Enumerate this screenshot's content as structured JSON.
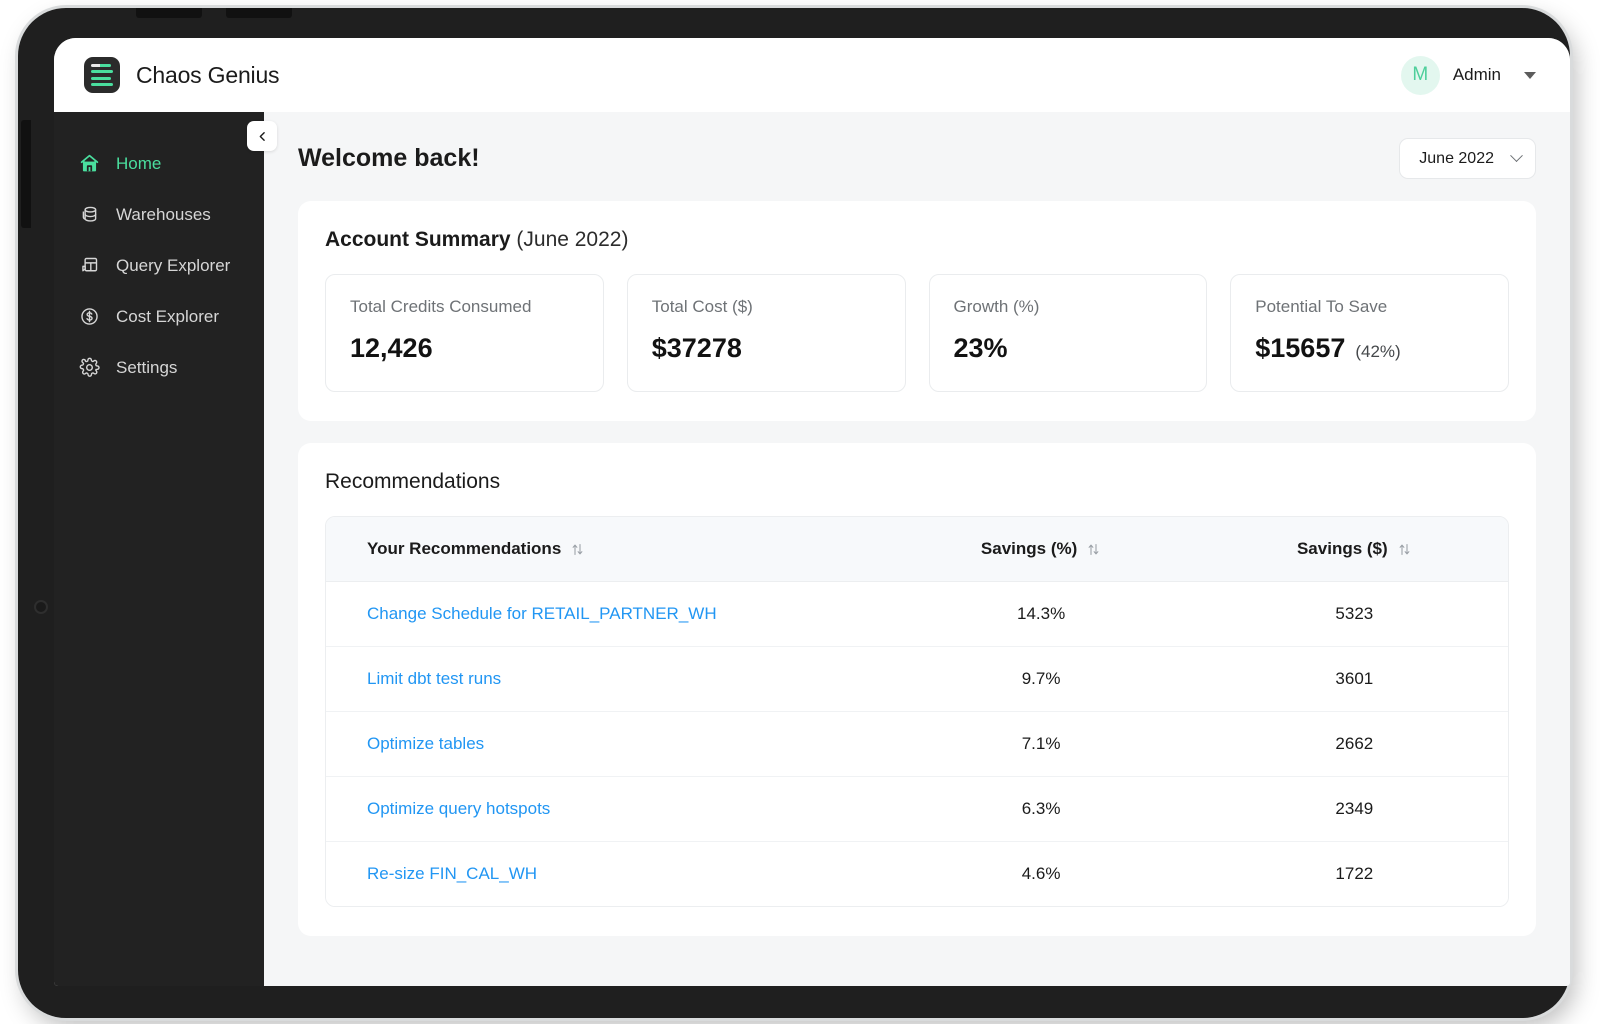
{
  "app": {
    "brand_name": "Chaos Genius",
    "logo_icon": "chaos-genius-logo"
  },
  "user": {
    "avatar_initial": "M",
    "name": "Admin",
    "caret_icon": "caret-down-icon"
  },
  "sidebar": {
    "collapse_icon": "chevron-left-icon",
    "items": [
      {
        "label": "Home",
        "icon": "home-icon",
        "active": true
      },
      {
        "label": "Warehouses",
        "icon": "database-stack-icon",
        "active": false
      },
      {
        "label": "Query Explorer",
        "icon": "query-icon",
        "active": false
      },
      {
        "label": "Cost Explorer",
        "icon": "dollar-circle-icon",
        "active": false
      },
      {
        "label": "Settings",
        "icon": "gear-icon",
        "active": false
      }
    ]
  },
  "page": {
    "title": "Welcome back!",
    "month_picker": {
      "value": "June 2022",
      "chevron_icon": "chevron-down-icon"
    }
  },
  "account_summary": {
    "title": "Account Summary",
    "period": "(June 2022)",
    "cards": [
      {
        "label": "Total Credits Consumed",
        "value": "12,426",
        "sub": ""
      },
      {
        "label": "Total Cost ($)",
        "value": "$37278",
        "sub": ""
      },
      {
        "label": "Growth (%)",
        "value": "23%",
        "sub": ""
      },
      {
        "label": "Potential To Save",
        "value": "$15657",
        "sub": "(42%)"
      }
    ]
  },
  "recommendations": {
    "title": "Recommendations",
    "columns": [
      {
        "label": "Your Recommendations",
        "sort_icon": "sort-updown-icon"
      },
      {
        "label": "Savings (%)",
        "sort_icon": "sort-updown-icon"
      },
      {
        "label": "Savings ($)",
        "sort_icon": "sort-updown-icon"
      }
    ],
    "rows": [
      {
        "name": "Change Schedule for RETAIL_PARTNER_WH",
        "savings_pct": "14.3%",
        "savings_amt": "5323"
      },
      {
        "name": "Limit dbt test runs",
        "savings_pct": "9.7%",
        "savings_amt": "3601"
      },
      {
        "name": "Optimize tables",
        "savings_pct": "7.1%",
        "savings_amt": "2662"
      },
      {
        "name": "Optimize query hotspots",
        "savings_pct": "6.3%",
        "savings_amt": "2349"
      },
      {
        "name": "Re-size FIN_CAL_WH",
        "savings_pct": "4.6%",
        "savings_amt": "1722"
      }
    ]
  },
  "colors": {
    "accent_green": "#4ade9e",
    "link_blue": "#2196f3",
    "sidebar_bg": "#222222",
    "page_bg": "#f5f6f7",
    "bezel": "#1f1f1f"
  }
}
